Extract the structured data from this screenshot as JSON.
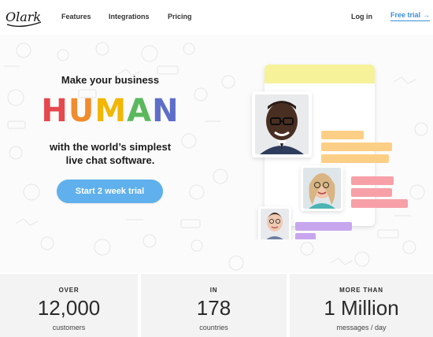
{
  "header": {
    "logo_text": "Olark",
    "nav": [
      {
        "label": "Features"
      },
      {
        "label": "Integrations"
      },
      {
        "label": "Pricing"
      }
    ],
    "login_label": "Log in",
    "free_trial_label": "Free trial",
    "free_trial_icon": "arrow-right-icon"
  },
  "hero": {
    "tagline_top": "Make your business",
    "human_letters": [
      {
        "char": "H",
        "color": "#e5484d"
      },
      {
        "char": "U",
        "color": "#f08c2e"
      },
      {
        "char": "M",
        "color": "#f2b705"
      },
      {
        "char": "A",
        "color": "#5bb85d"
      },
      {
        "char": "N",
        "color": "#5d6ec9"
      }
    ],
    "tagline_bottom_1": "with the world’s simplest",
    "tagline_bottom_2": "live chat software.",
    "cta_label": "Start 2 week trial",
    "cta_color": "#5fb0ec"
  },
  "illustration": {
    "header_bar_color": "#f6f29a",
    "bubble_orange": "#fdcf86",
    "bubble_pink": "#f7a0a8",
    "bubble_purple": "#c8a6ee"
  },
  "stats": [
    {
      "label": "OVER",
      "value": "12,000",
      "unit": "customers"
    },
    {
      "label": "IN",
      "value": "178",
      "unit": "countries"
    },
    {
      "label": "MORE THAN",
      "value": "1 Million",
      "unit": "messages / day"
    }
  ]
}
